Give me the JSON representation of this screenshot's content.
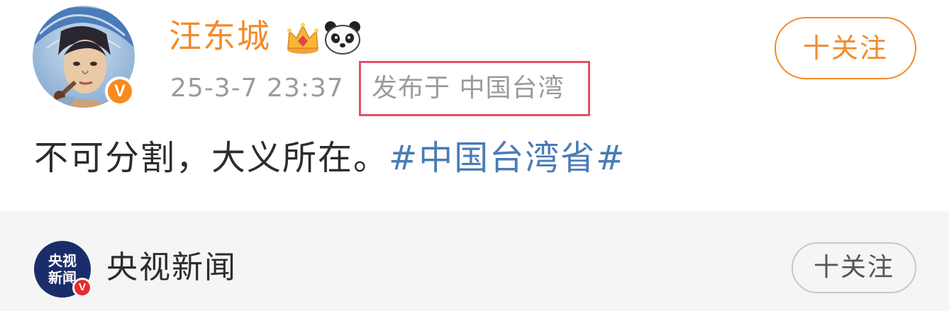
{
  "post": {
    "username": "汪东城",
    "post_time": "25-3-7 23:37",
    "location": "发布于 中国台湾",
    "follow_label": "十关注",
    "content_text": "不可分割，大义所在。",
    "hashtag": "#中国台湾省#",
    "badge_letter": "V",
    "username_color": "#f38a2a",
    "hashtag_color": "#4a7cb5",
    "highlight_color": "#e3506a",
    "icons": [
      "crown-icon",
      "panda-icon",
      "verified-badge-icon"
    ]
  },
  "repost": {
    "account_name": "央视新闻",
    "avatar_text_line1": "央视",
    "avatar_text_line2": "新闻",
    "badge_letter": "V",
    "follow_label": "十关注"
  }
}
